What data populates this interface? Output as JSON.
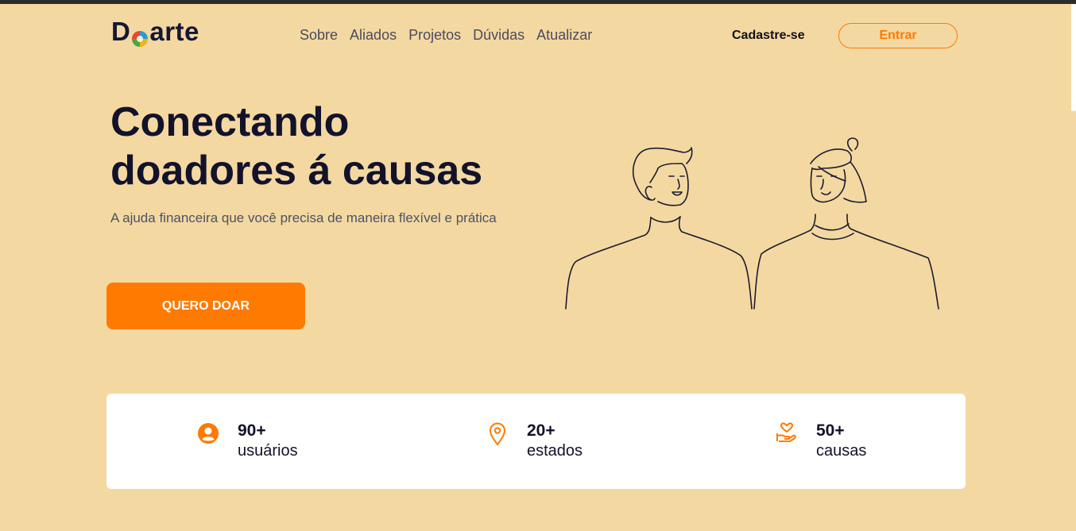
{
  "header": {
    "logo_left": "D",
    "logo_right": "arte",
    "nav": [
      "Sobre",
      "Aliados",
      "Projetos",
      "Dúvidas",
      "Atualizar"
    ],
    "signup_label": "Cadastre-se",
    "login_label": "Entrar"
  },
  "hero": {
    "title_line1": "Conectando",
    "title_line2": "doadores á causas",
    "subtitle": "A ajuda financeira que você precisa de maneira flexível e prática",
    "cta_label": "QUERO DOAR"
  },
  "stats": [
    {
      "icon": "user-icon",
      "value": "90+",
      "label": "usuários"
    },
    {
      "icon": "location-pin-icon",
      "value": "20+",
      "label": "estados"
    },
    {
      "icon": "hand-heart-icon",
      "value": "50+",
      "label": "causas"
    }
  ],
  "colors": {
    "background": "#f4d8a2",
    "accent": "#ff7a00",
    "text_dark": "#12122b"
  }
}
